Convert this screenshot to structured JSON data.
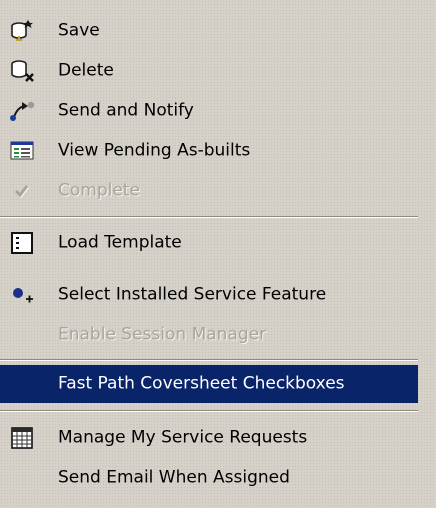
{
  "menu": {
    "items": [
      {
        "label": "Save",
        "icon": "save-icon",
        "state": "enabled"
      },
      {
        "label": "Delete",
        "icon": "delete-icon",
        "state": "enabled"
      },
      {
        "label": "Send and Notify",
        "icon": "send-notify-icon",
        "state": "enabled"
      },
      {
        "label": "View Pending As-builts",
        "icon": "view-pending-icon",
        "state": "enabled"
      },
      {
        "label": "Complete",
        "icon": "checkmark-icon",
        "state": "disabled"
      },
      {
        "label": "Load Template",
        "icon": "template-icon",
        "state": "enabled"
      },
      {
        "label": "Select Installed Service Feature",
        "icon": "select-feature-icon",
        "state": "enabled"
      },
      {
        "label": "Enable Session Manager",
        "icon": "",
        "state": "disabled"
      },
      {
        "label": "Fast Path Coversheet Checkboxes",
        "icon": "",
        "state": "selected"
      },
      {
        "label": "Manage My Service Requests",
        "icon": "calendar-grid-icon",
        "state": "enabled"
      },
      {
        "label": "Send Email When Assigned",
        "icon": "",
        "state": "enabled"
      }
    ],
    "colors": {
      "background": "#d4d0c8",
      "selection": "#0a246a",
      "disabled_text": "#a9a59c"
    }
  }
}
